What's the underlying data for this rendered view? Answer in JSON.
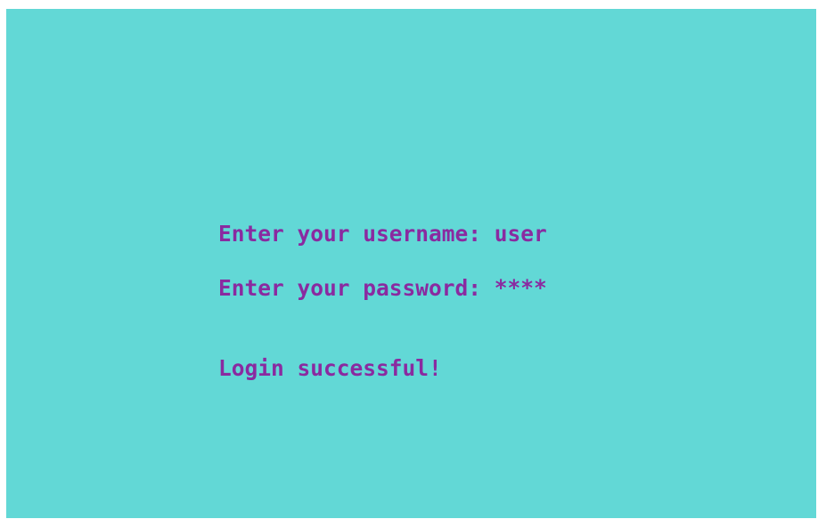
{
  "terminal": {
    "background_color": "#62d8d6",
    "text_color": "#8a2aa0",
    "lines": [
      "Enter your username: user",
      "Enter your password: ****",
      "Login successful!"
    ]
  }
}
